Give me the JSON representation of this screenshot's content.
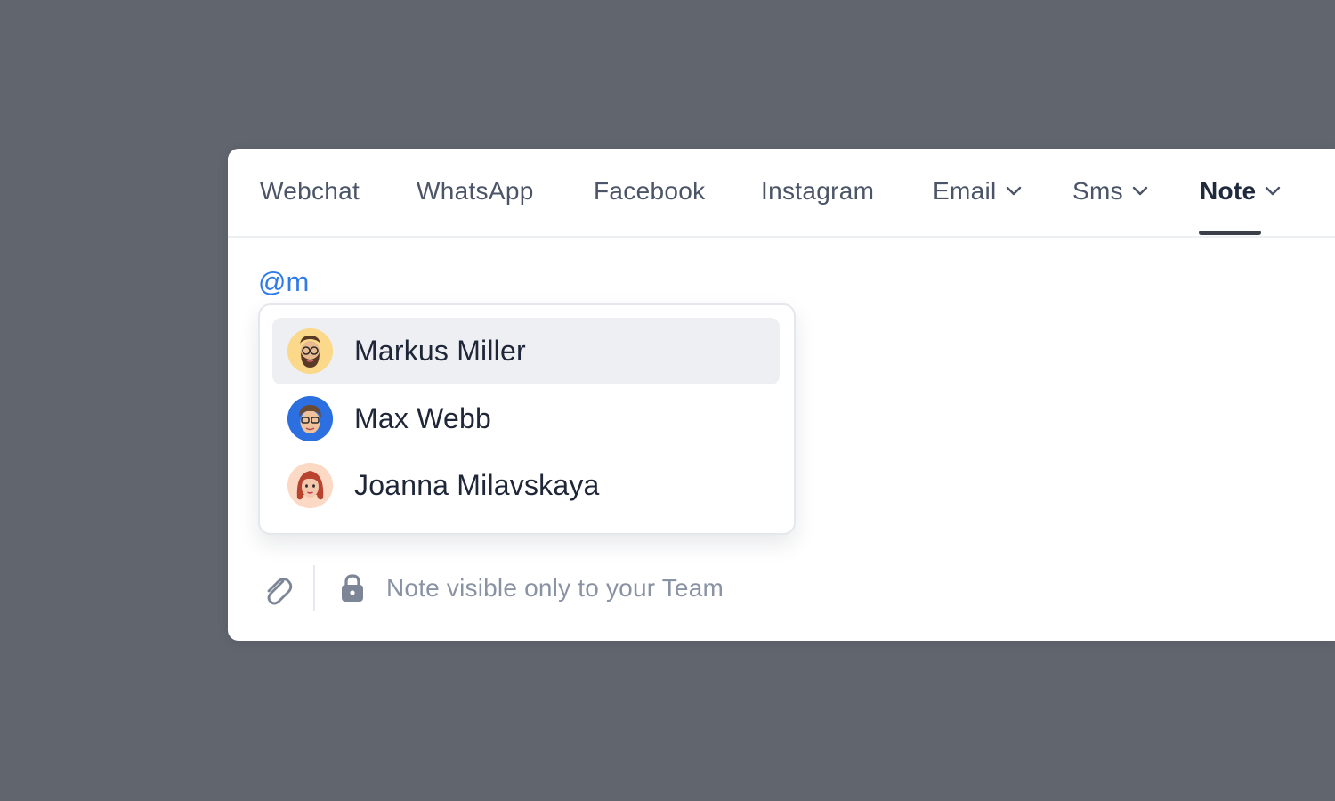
{
  "tabs": [
    {
      "label": "Webchat",
      "has_dropdown": false,
      "active": false
    },
    {
      "label": "WhatsApp",
      "has_dropdown": false,
      "active": false
    },
    {
      "label": "Facebook",
      "has_dropdown": false,
      "active": false
    },
    {
      "label": "Instagram",
      "has_dropdown": false,
      "active": false
    },
    {
      "label": "Email",
      "has_dropdown": true,
      "active": false
    },
    {
      "label": "Sms",
      "has_dropdown": true,
      "active": false
    },
    {
      "label": "Note",
      "has_dropdown": true,
      "active": true
    }
  ],
  "composer": {
    "text": "@m"
  },
  "mention_suggestions": [
    {
      "name": "Markus Miller",
      "selected": true,
      "avatar_color": "#fbd88a",
      "avatar_icon": "bearded-man-glasses-memoji"
    },
    {
      "name": "Max Webb",
      "selected": false,
      "avatar_color": "#2c6fe0",
      "avatar_icon": "man-glasses-memoji"
    },
    {
      "name": "Joanna Milavskaya",
      "selected": false,
      "avatar_color": "#fcd9c5",
      "avatar_icon": "red-haired-woman-memoji"
    }
  ],
  "footer": {
    "attach_icon": "paperclip-icon",
    "lock_icon": "lock-icon",
    "visibility_note": "Note visible only to your Team"
  },
  "colors": {
    "background": "#61656e",
    "mention": "#2f7bea",
    "active_tab": "#1f2a3d",
    "tab_text": "#4b5567",
    "muted_text": "#8a93a3"
  }
}
